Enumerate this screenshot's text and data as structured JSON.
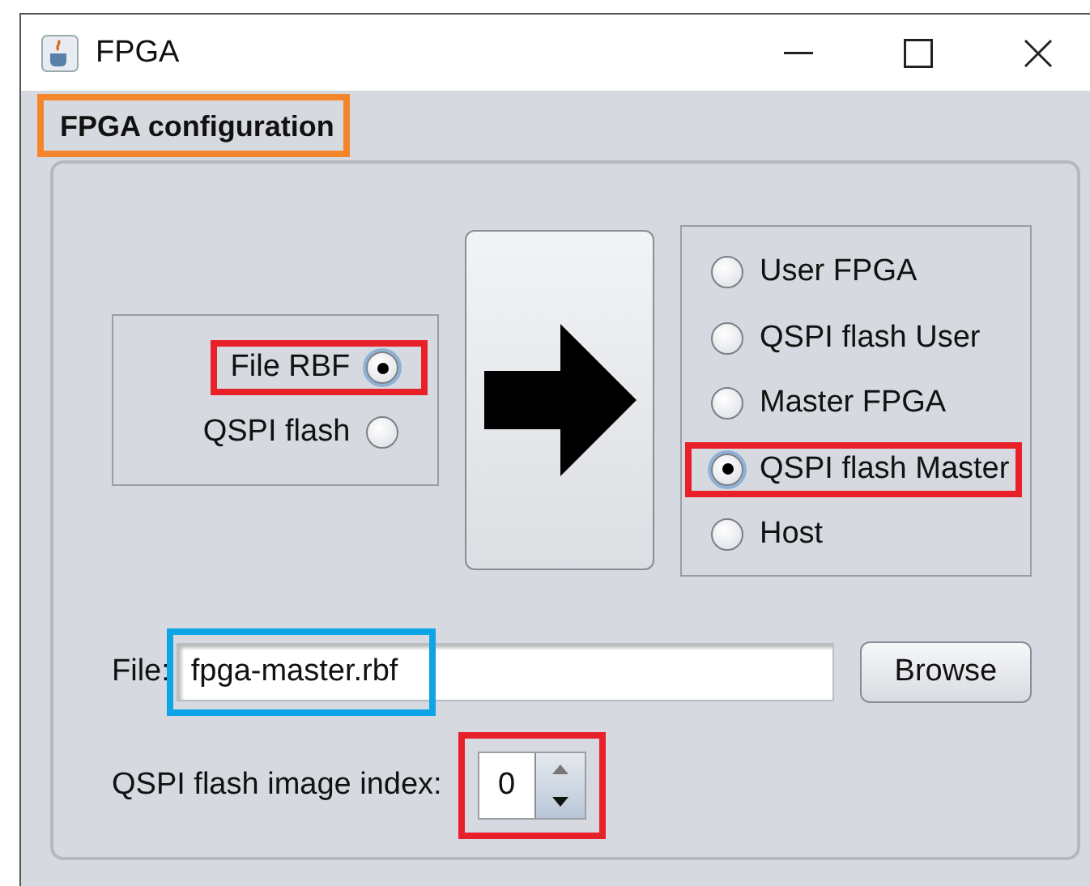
{
  "window": {
    "title": "FPGA"
  },
  "group": {
    "title": "FPGA configuration",
    "color": "#f5852a"
  },
  "sources": [
    {
      "label": "File RBF",
      "selected": true,
      "color": "#e8202a"
    },
    {
      "label": "QSPI flash",
      "selected": false
    }
  ],
  "targets": [
    {
      "label": "User FPGA",
      "selected": false
    },
    {
      "label": "QSPI flash User",
      "selected": false
    },
    {
      "label": "Master FPGA",
      "selected": false
    },
    {
      "label": "QSPI flash Master",
      "selected": true,
      "color": "#e8202a"
    },
    {
      "label": "Host",
      "selected": false
    }
  ],
  "file": {
    "label": "File:",
    "value": "fpga-master.rbf",
    "color": "#0ea5e6",
    "button": "Browse"
  },
  "index": {
    "label": "QSPI flash image index:",
    "value": "0",
    "color": "#e8202a"
  }
}
